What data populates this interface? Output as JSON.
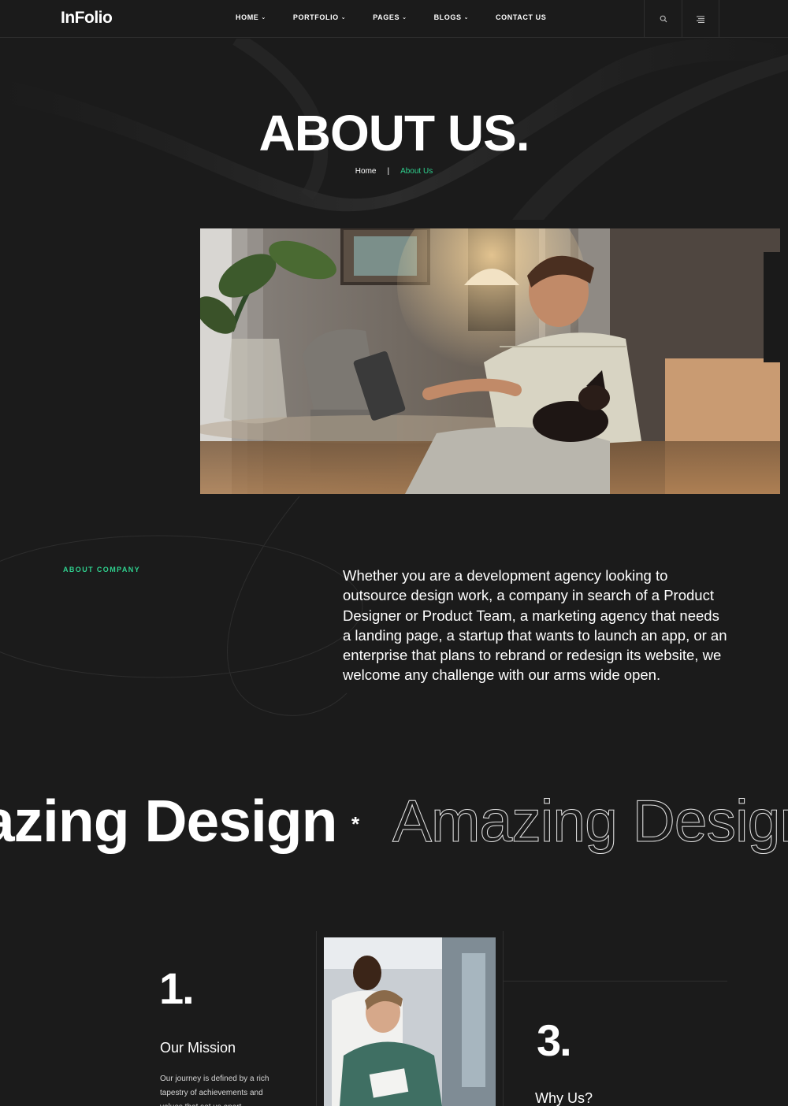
{
  "header": {
    "logo": "InFolio",
    "nav": [
      {
        "label": "HOME",
        "caret": true
      },
      {
        "label": "PORTFOLIO",
        "caret": true
      },
      {
        "label": "PAGES",
        "caret": true
      },
      {
        "label": "BLOGS",
        "caret": true
      },
      {
        "label": "CONTACT US",
        "caret": false
      }
    ],
    "caret_glyph": "⌄",
    "icons": [
      "search-icon",
      "menu-icon"
    ]
  },
  "hero": {
    "title": "ABOUT US.",
    "breadcrumb": {
      "home": "Home",
      "separator": "|",
      "current": "About Us"
    }
  },
  "about": {
    "label": "ABOUT COMPANY",
    "text": "Whether you are a development agency looking to outsource design work, a company in search of a Product Designer or Product Team, a marketing agency that needs a landing page, a startup that wants to launch an app, or an enterprise that plans to rebrand or redesign its website, we welcome any challenge with our arms wide open."
  },
  "marquee": {
    "filled_text": "Amazing Design",
    "separator": "*",
    "outline_text": "Amazing Design"
  },
  "cards": [
    {
      "number": "1.",
      "title": "Our Mission",
      "text": "Our journey is defined by a rich tapestry of achievements and values that set us apart."
    },
    {
      "number": "3.",
      "title": "Why Us?"
    }
  ],
  "colors": {
    "background": "#1b1b1b",
    "accent": "#2fd08e",
    "text": "#ffffff",
    "divider": "#2e2e2e"
  }
}
